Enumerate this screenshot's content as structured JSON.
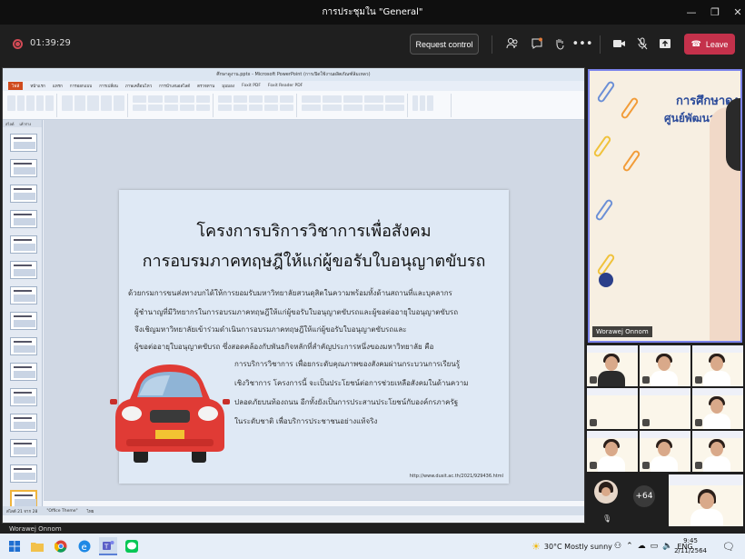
{
  "window": {
    "title": "การประชุมใน \"General\""
  },
  "toolbar": {
    "timer": "01:39:29",
    "request_control": "Request control",
    "leave": "Leave"
  },
  "presentation": {
    "window_title": "ศึกษาดูงาน.pptx - Microsoft PowerPoint (การเปิดใช้งานผลิตภัณฑ์ล้มเหลว)",
    "ribbon_tabs": [
      "ไฟล์",
      "หน้าแรก",
      "แทรก",
      "การออกแบบ",
      "การเปลี่ยน",
      "ภาพเคลื่อนไหว",
      "การนำเสนอสไลด์",
      "ตรวจทาน",
      "มุมมอง",
      "Foxit PDF",
      "Foxit Reader PDF"
    ],
    "thumb_tabs": [
      "สไลด์",
      "เค้าร่าง"
    ],
    "slide": {
      "title_line1": "โครงการบริการวิชาการเพื่อสังคม",
      "title_line2": "การอบรมภาคทฤษฎีให้แก่ผู้ขอรับใบอนุญาตขับรถ",
      "para_lines": [
        "ด้วยกรมการขนส่งทางบกได้ให้การยอมรับมหาวิทยาลัยสวนดุสิตในความพร้อมทั้งด้านสถานที่และบุคลากร",
        "ผู้ชำนาญที่มีวิทยากรในการอบรมภาคทฤษฎีให้แก่ผู้ขอรับใบอนุญาตขับรถและผู้ขอต่ออายุใบอนุญาตขับรถ",
        "จึงเชิญมหาวิทยาลัยเข้าร่วมดำเนินการอบรมภาคทฤษฎีให้แก่ผู้ขอรับใบอนุญาตขับรถและ",
        "ผู้ขอต่ออายุใบอนุญาตขับรถ ซึ่งสอดคล้องกับพันธกิจหลักที่สำคัญประการหนึ่งของมหาวิทยาลัย คือ",
        "การบริการวิชาการ เพื่อยกระดับคุณภาพของสังคมผ่านกระบวนการเรียนรู้",
        "เชิงวิชาการ โครงการนี้ จะเป็นประโยชน์ต่อการช่วยเหลือสังคมในด้านความ",
        "ปลอดภัยบนท้องถนน อีกทั้งยังเป็นการประสานประโยชน์กับองค์กรภาครัฐ",
        "ในระดับชาติ เพื่อบริการประชาชนอย่างแท้จริง"
      ],
      "url": "http://www.dusit.ac.th/2021/929436.html"
    },
    "status": [
      "สไลด์ 21 จาก 28",
      "\"Office Theme\"",
      "ไทย"
    ],
    "presenter": "Worawej Onnom"
  },
  "participants": {
    "main": {
      "name": "Worawej Onnom",
      "title_line1": "การศึกษาดูง",
      "title_line2": "ศูนย์พัฒนาทุนมน"
    },
    "more_count": "+64"
  },
  "taskbar": {
    "weather": "30°C  Mostly sunny",
    "lang": "ENG",
    "time": "9:45",
    "date": "2/11/2564"
  },
  "colors": {
    "leave": "#c4314b",
    "accent": "#7b83eb",
    "slide_bg": "#dfe9f5"
  }
}
